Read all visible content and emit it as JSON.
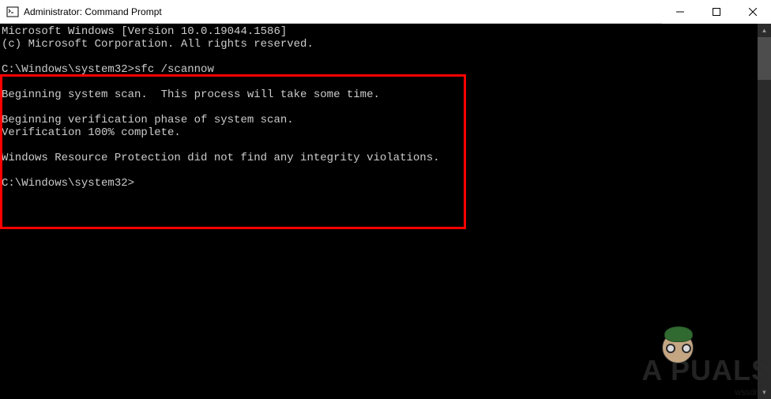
{
  "window": {
    "title": "Administrator: Command Prompt"
  },
  "console": {
    "line1": "Microsoft Windows [Version 10.0.19044.1586]",
    "line2": "(c) Microsoft Corporation. All rights reserved.",
    "blank1": "",
    "prompt1": "C:\\Windows\\system32>sfc /scannow",
    "blank2": "",
    "line3": "Beginning system scan.  This process will take some time.",
    "blank3": "",
    "line4": "Beginning verification phase of system scan.",
    "line5": "Verification 100% complete.",
    "blank4": "",
    "line6": "Windows Resource Protection did not find any integrity violations.",
    "blank5": "",
    "prompt2": "C:\\Windows\\system32>"
  },
  "watermark": {
    "text": "A  PUALS",
    "url": "wssdn.c"
  }
}
